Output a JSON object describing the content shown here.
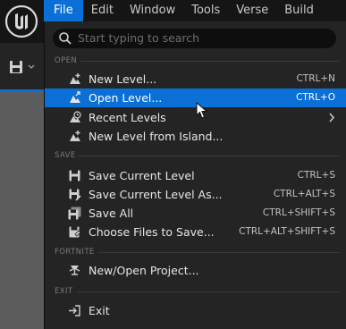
{
  "menubar": {
    "items": [
      {
        "label": "File",
        "active": true
      },
      {
        "label": "Edit",
        "active": false
      },
      {
        "label": "Window",
        "active": false
      },
      {
        "label": "Tools",
        "active": false
      },
      {
        "label": "Verse",
        "active": false
      },
      {
        "label": "Build",
        "active": false
      }
    ]
  },
  "search": {
    "placeholder": "Start typing to search"
  },
  "sections": {
    "open": "OPEN",
    "save": "SAVE",
    "fortnite": "FORTNITE",
    "exit": "EXIT"
  },
  "items": {
    "new_level": {
      "label": "New Level...",
      "shortcut": "CTRL+N",
      "icon": "new-level-icon"
    },
    "open_level": {
      "label": "Open Level...",
      "shortcut": "CTRL+O",
      "icon": "open-level-icon"
    },
    "recent_levels": {
      "label": "Recent Levels",
      "icon": "recent-levels-icon"
    },
    "new_level_island": {
      "label": "New Level from Island...",
      "icon": "new-level-icon"
    },
    "save_current": {
      "label": "Save Current Level",
      "shortcut": "CTRL+S",
      "icon": "save-icon"
    },
    "save_current_as": {
      "label": "Save Current Level As...",
      "shortcut": "CTRL+ALT+S",
      "icon": "save-as-icon"
    },
    "save_all": {
      "label": "Save All",
      "shortcut": "CTRL+SHIFT+S",
      "icon": "save-all-icon"
    },
    "choose_files": {
      "label": "Choose Files to Save...",
      "shortcut": "CTRL+ALT+SHIFT+S",
      "icon": "choose-files-icon"
    },
    "new_open_project": {
      "label": "New/Open Project...",
      "icon": "project-icon"
    },
    "exit": {
      "label": "Exit",
      "icon": "exit-icon"
    }
  },
  "colors": {
    "accent": "#0a6fd6",
    "menu_bg": "#242424",
    "topbar_bg": "#151515"
  }
}
